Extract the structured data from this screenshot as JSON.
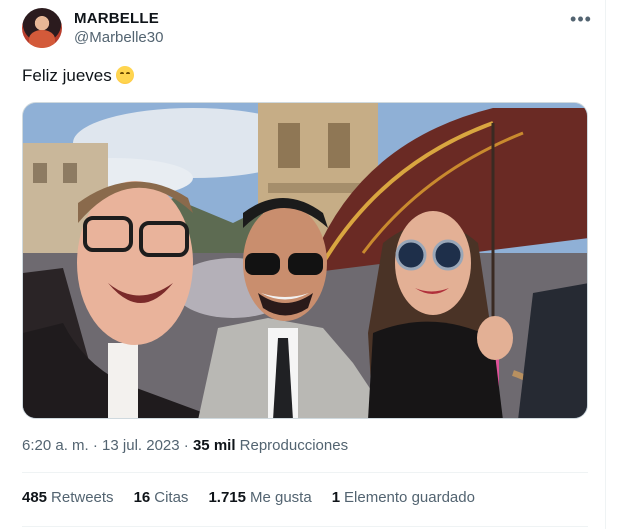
{
  "tweet": {
    "author_name": "MARBELLE",
    "author_handle": "@Marbelle30",
    "more_label": "•••",
    "text": "Feliz jueves",
    "emoji": "face-with-hand-over-mouth",
    "time": "6:20 a. m.",
    "sep1": " · ",
    "date": "13 jul. 2023",
    "sep2": " · ",
    "views_count": "35 mil",
    "views_label": " Reproducciones"
  },
  "stats": {
    "retweets_count": "485",
    "retweets_label": "Retweets",
    "quotes_count": "16",
    "quotes_label": "Citas",
    "likes_count": "1.715",
    "likes_label": "Me gusta",
    "bookmarks_count": "1",
    "bookmarks_label": "Elemento guardado"
  },
  "colors": {
    "text_primary": "#0f1419",
    "text_secondary": "#536471",
    "border": "#eff3f4"
  }
}
